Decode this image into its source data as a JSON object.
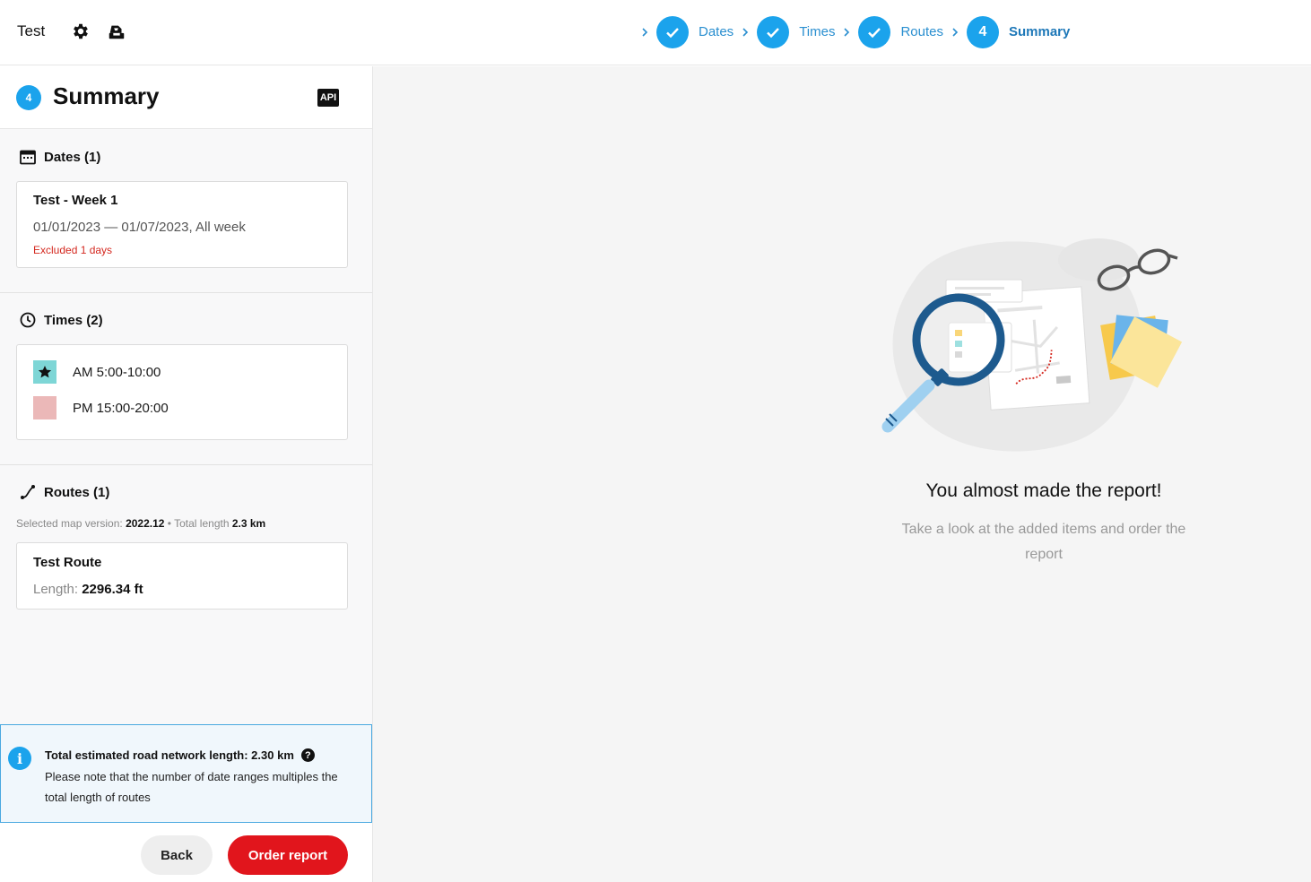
{
  "header": {
    "title": "Test",
    "steps": [
      {
        "label": "Dates",
        "state": "done"
      },
      {
        "label": "Times",
        "state": "done"
      },
      {
        "label": "Routes",
        "state": "done"
      },
      {
        "label": "Summary",
        "state": "active",
        "number": "4"
      }
    ]
  },
  "summary": {
    "badge": "4",
    "title": "Summary",
    "api_label": "API"
  },
  "dates": {
    "heading": "Dates (1)",
    "items": [
      {
        "name": "Test - Week 1",
        "range": "01/01/2023 — 01/07/2023, All week",
        "excluded": "Excluded 1 days"
      }
    ]
  },
  "times": {
    "heading": "Times (2)",
    "items": [
      {
        "label": "AM 5:00-10:00",
        "color": "#7ed6d6",
        "icon": "star-icon"
      },
      {
        "label": "PM 15:00-20:00",
        "color": "#ebb8b8",
        "icon": ""
      }
    ]
  },
  "routes": {
    "heading": "Routes (1)",
    "map_version_label": "Selected map version:",
    "map_version": "2022.12",
    "separator": " • ",
    "total_length_label": "Total length",
    "total_length": "2.3 km",
    "items": [
      {
        "name": "Test Route",
        "length_label": "Length:",
        "length": "2296.34 ft"
      }
    ]
  },
  "info": {
    "title": "Total estimated road network length: 2.30 km",
    "text": "Please note that the number of date ranges multiples the total length of routes"
  },
  "buttons": {
    "back": "Back",
    "order": "Order report"
  },
  "empty_state": {
    "title": "You almost made the report!",
    "subtitle": "Take a look at the added items and order the report"
  },
  "colors": {
    "accent": "#1ba3ec",
    "primary_button": "#e1151c",
    "excluded_text": "#d4281f"
  }
}
